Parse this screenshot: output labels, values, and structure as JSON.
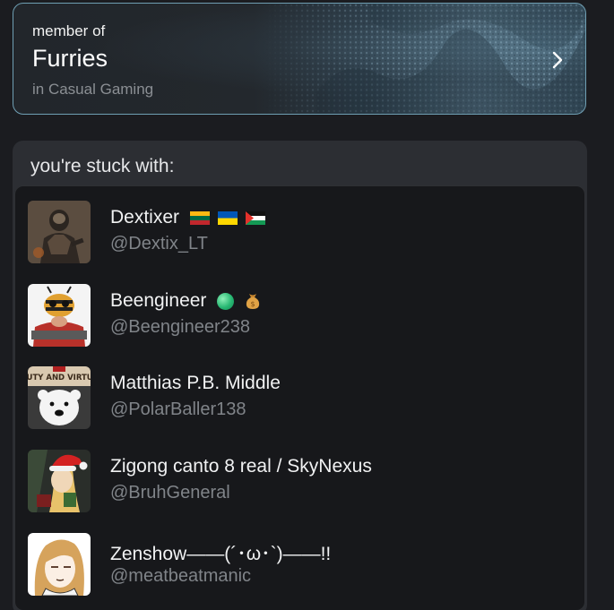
{
  "community": {
    "member_of_label": "member of",
    "name": "Furries",
    "parent": "in Casual Gaming",
    "accent_border": "#6f9fb3",
    "chevron_icon": "chevron-right-icon"
  },
  "stuck_with": {
    "title": "you're stuck with:",
    "users": [
      {
        "name": "Dextixer",
        "handle": "@Dextix_LT",
        "badges": [
          "lithuania-flag-icon",
          "ukraine-flag-icon",
          "palestine-flag-icon"
        ],
        "avatar_icon": "armored-soldier-avatar"
      },
      {
        "name": "Beengineer",
        "handle": "@Beengineer238",
        "badges": [
          "green-circle-icon",
          "money-bag-icon"
        ],
        "avatar_icon": "bee-engineer-avatar"
      },
      {
        "name": "Matthias P.B. Middle",
        "handle": "@PolarBaller138",
        "badges": [],
        "avatar_icon": "polar-bear-avatar"
      },
      {
        "name": "Zigong canto 8 real / SkyNexus",
        "handle": "@BruhGeneral",
        "badges": [],
        "avatar_icon": "santa-hat-character-avatar"
      },
      {
        "name": "Zenshow——(´･ω･`)——!!",
        "handle": "@meatbeatmanic",
        "badges": [],
        "avatar_icon": "anime-character-avatar"
      }
    ]
  }
}
